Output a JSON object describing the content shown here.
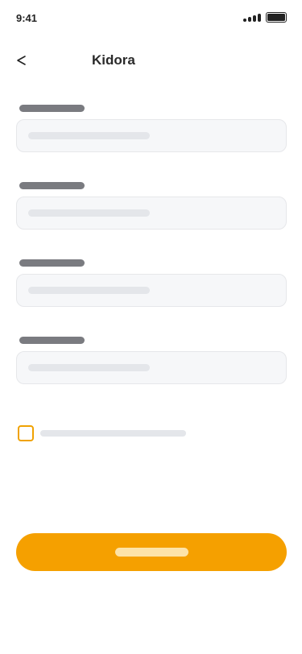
{
  "status_bar": {
    "time": "9:41"
  },
  "nav": {
    "title": "Kidora",
    "back_icon": "chevron-left-icon"
  },
  "form": {
    "fields": [
      {
        "label": "",
        "value": "",
        "placeholder": ""
      },
      {
        "label": "",
        "value": "",
        "placeholder": ""
      },
      {
        "label": "",
        "value": "",
        "placeholder": ""
      },
      {
        "label": "",
        "value": "",
        "placeholder": ""
      }
    ],
    "checkbox": {
      "checked": false,
      "label": ""
    },
    "submit_label": ""
  },
  "colors": {
    "accent": "#f5a000",
    "checkbox_border": "#f0a202",
    "input_bg": "#f6f7f9",
    "label_placeholder": "#7a7b80",
    "text_placeholder": "#e4e6ea"
  }
}
